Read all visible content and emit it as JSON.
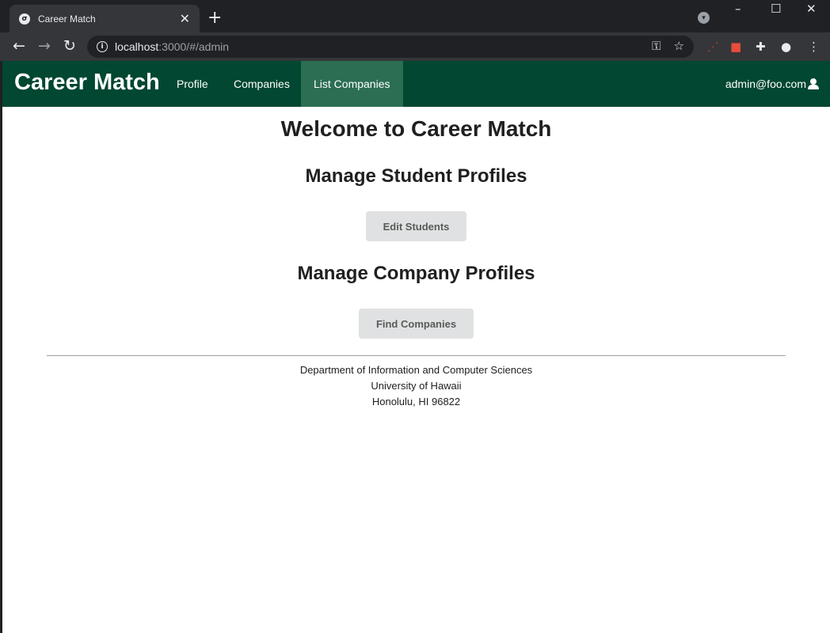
{
  "browser": {
    "tab_title": "Career Match",
    "tab_favicon": "σ",
    "tab_close": "✕",
    "new_tab": "+",
    "url_host": "localhost",
    "url_path": ":3000/#/admin",
    "icons": [
      "back-icon",
      "forward-icon",
      "reload-icon",
      "info-icon",
      "key-icon",
      "star-icon",
      "extensions-icon",
      "profile-icon",
      "menu-icon"
    ]
  },
  "navbar": {
    "brand": "Career Match",
    "links": [
      "Profile",
      "Companies",
      "List Companies"
    ],
    "active": "List Companies",
    "user": "admin@foo.com",
    "background": "#024731"
  },
  "main": {
    "title": "Welcome to Career Match",
    "student_heading": "Manage Student Profiles",
    "student_button": "Edit Students",
    "company_heading": "Manage Company Profiles",
    "company_button": "Find Companies"
  },
  "footer": {
    "line1": "Department of Information and Computer Sciences",
    "line2": "University of Hawaii",
    "line3": "Honolulu, HI 96822"
  }
}
